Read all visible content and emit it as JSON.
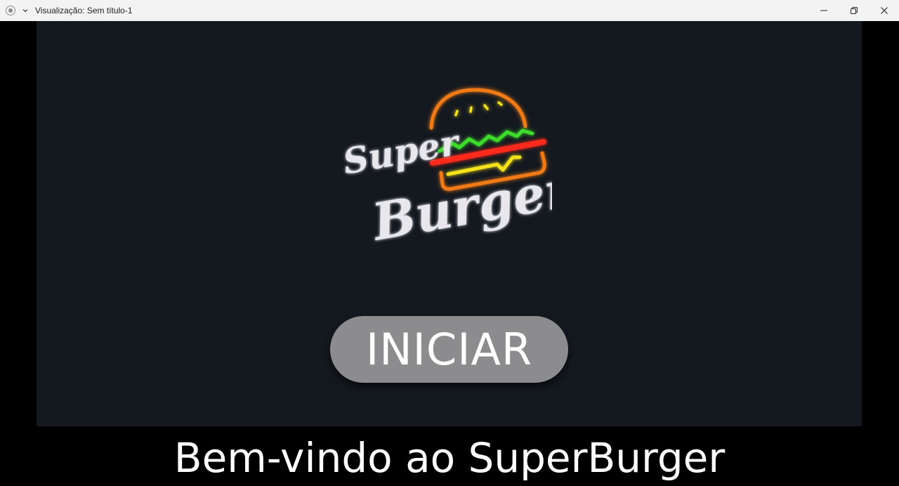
{
  "window": {
    "title": "Visualização: Sem título-1",
    "controls": {
      "minimize_icon": "minimize-icon",
      "restore_icon": "restore-icon",
      "close_icon": "close-icon"
    }
  },
  "logo": {
    "name": "superburger-neon-logo",
    "text_line1": "Super",
    "text_line2": "Burger",
    "colors": {
      "bun": "#f07a12",
      "lettuce": "#3ddc2a",
      "patty": "#ff2a1a",
      "cheese": "#f5e21b",
      "lettering": "#e8e8ec"
    }
  },
  "main": {
    "start_button_label": "INICIAR",
    "welcome_text": "Bem-vindo ao SuperBurger"
  },
  "colors": {
    "stage_bg": "#141920",
    "outer_bg": "#000000",
    "button_bg": "#8c8c8e",
    "titlebar_bg": "#f3f3f3"
  }
}
